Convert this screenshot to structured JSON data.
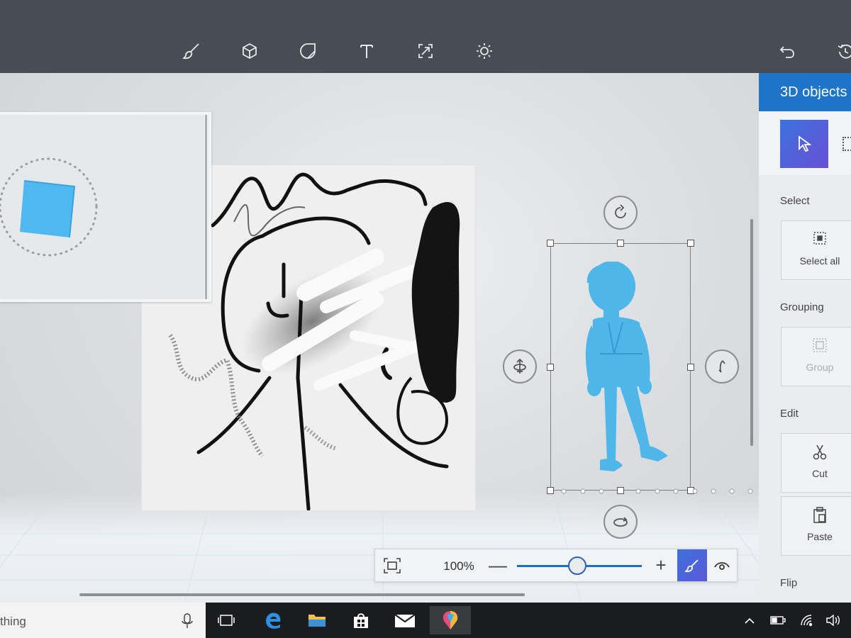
{
  "toolbar": {
    "tools": [
      {
        "name": "brushes-icon"
      },
      {
        "name": "3d-objects-icon"
      },
      {
        "name": "stickers-icon"
      },
      {
        "name": "text-icon"
      },
      {
        "name": "canvas-icon"
      },
      {
        "name": "effects-icon"
      }
    ],
    "undo": "undo-icon",
    "history": "history-icon"
  },
  "zoom": {
    "percent": "100%",
    "minus": "—",
    "plus": "+",
    "level": 0.45
  },
  "panel": {
    "title": "3D objects",
    "sections": {
      "select": "Select",
      "grouping": "Grouping",
      "edit": "Edit",
      "flip": "Flip"
    },
    "buttons": {
      "select_all": "Select all",
      "group": "Group",
      "cut": "Cut",
      "paste": "Paste"
    }
  },
  "taskbar": {
    "search_text": "thing"
  },
  "colors": {
    "accent": "#1e74c8",
    "model_blue": "#4fb6ea",
    "toolbar_bg": "#474c55"
  }
}
